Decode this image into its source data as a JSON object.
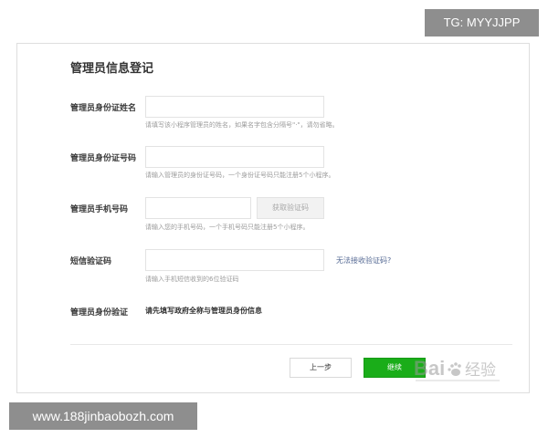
{
  "overlays": {
    "top_tag": "TG: MYYJJPP",
    "bottom_tag": "www.188jinbaobozh.com"
  },
  "form": {
    "title": "管理员信息登记",
    "fields": [
      {
        "label": "管理员身份证姓名",
        "value": "",
        "hint": "请填写该小程序管理员的姓名，如果名字包含分隔号\"·\"，请勿省略。"
      },
      {
        "label": "管理员身份证号码",
        "value": "",
        "hint": "请输入管理员的身份证号码，一个身份证号码只能注册5个小程序。"
      },
      {
        "label": "管理员手机号码",
        "value": "",
        "hint": "请输入您的手机号码，一个手机号码只能注册5个小程序。",
        "action": "获取验证码"
      },
      {
        "label": "短信验证码",
        "value": "",
        "hint": "请输入手机短信收到的6位验证码",
        "help_link": "无法接收验证码?"
      },
      {
        "label": "管理员身份验证",
        "text": "请先填写政府全称与管理员身份信息"
      }
    ],
    "buttons": {
      "prev": "上一步",
      "next": "继续"
    }
  },
  "watermark": {
    "text": "Bai经验",
    "color": "#9a9a9a"
  },
  "colors": {
    "accent_green": "#1aad19",
    "link_blue": "#576b95",
    "overlay_gray": "#8e8e8e"
  }
}
